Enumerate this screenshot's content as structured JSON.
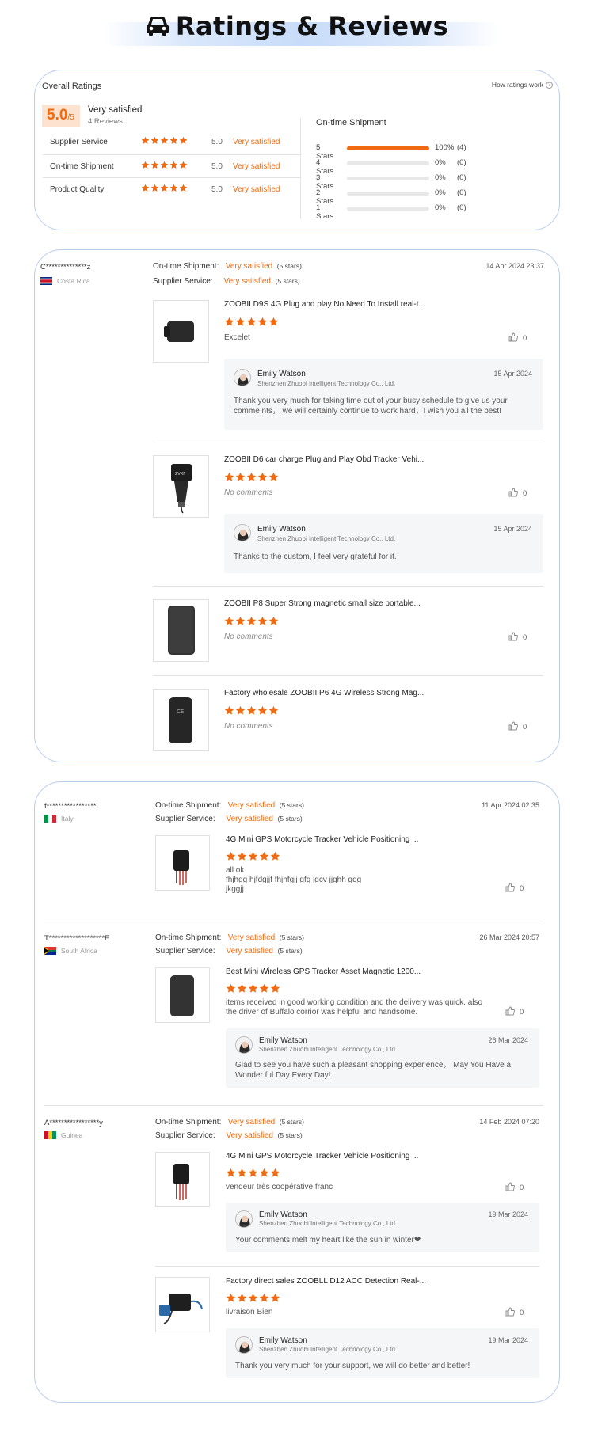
{
  "header": {
    "title": "Ratings & Reviews",
    "icon": "car-icon"
  },
  "colors": {
    "accent": "#f06a12",
    "border": "#b9cdec",
    "score_bg": "#fde2cf"
  },
  "overall": {
    "title": "Overall Ratings",
    "help_label": "How ratings work",
    "score": "5.0",
    "score_max": "/5",
    "satisfaction": "Very satisfied",
    "reviews_count": "4 Reviews",
    "categories": [
      {
        "label": "Supplier Service",
        "value": "5.0",
        "satisfaction": "Very satisfied",
        "stars": 5
      },
      {
        "label": "On-time Shipment",
        "value": "5.0",
        "satisfaction": "Very satisfied",
        "stars": 5
      },
      {
        "label": "Product Quality",
        "value": "5.0",
        "satisfaction": "Very satisfied",
        "stars": 5
      }
    ],
    "shipment_title": "On-time Shipment",
    "distribution": [
      {
        "label": "5 Stars",
        "percent": "100%",
        "count": "(4)",
        "fill": 100
      },
      {
        "label": "4 Stars",
        "percent": "0%",
        "count": "(0)",
        "fill": 0
      },
      {
        "label": "3 Stars",
        "percent": "0%",
        "count": "(0)",
        "fill": 0
      },
      {
        "label": "2 Stars",
        "percent": "0%",
        "count": "(0)",
        "fill": 0
      },
      {
        "label": "1 Stars",
        "percent": "0%",
        "count": "(0)",
        "fill": 0
      }
    ]
  },
  "metric_labels": {
    "shipment": "On-time Shipment:",
    "service": "Supplier Service:",
    "value": "Very satisfied",
    "stars": "(5 stars)"
  },
  "reply_author": {
    "name": "Emily Watson",
    "company": "Shenzhen Zhuobi Intelligent Technology Co., Ltd."
  },
  "reviews": [
    {
      "user": "C**************z",
      "country": "Costa Rica",
      "date": "14 Apr 2024 23:37",
      "items": [
        {
          "title": "ZOOBII D9S 4G Plug and play No Need To Install real-t...",
          "comment": "Excelet",
          "likes": "0",
          "reply": {
            "date": "15 Apr 2024",
            "text": "Thank you very much for taking time out of your busy schedule to give us your comme nts， we will certainly continue to work hard，I wish you all the best!"
          }
        },
        {
          "title": "ZOOBII D6 car charge Plug and Play Obd Tracker Vehi...",
          "comment": "No comments",
          "likes": "0",
          "reply": {
            "date": "15 Apr 2024",
            "text": "Thanks to the custom, I feel very grateful for it."
          }
        },
        {
          "title": "ZOOBII P8 Super Strong magnetic small size portable...",
          "comment": "No comments",
          "likes": "0"
        },
        {
          "title": "Factory wholesale ZOOBII P6 4G Wireless Strong Mag...",
          "comment": "No comments",
          "likes": "0"
        }
      ]
    },
    {
      "user": "f*****************i",
      "country": "Italy",
      "date": "11 Apr 2024 02:35",
      "items": [
        {
          "title": "4G Mini GPS Motorcycle Tracker Vehicle Positioning ...",
          "comment_lines": [
            "all ok",
            "fhjhgg hjfdgjjf fhjhfgjj gfg jgcv jjghh gdg",
            "jkggjj"
          ],
          "likes": "0"
        }
      ]
    },
    {
      "user": "T*******************E",
      "country": "South Africa",
      "date": "26 Mar 2024 20:57",
      "items": [
        {
          "title": "Best Mini Wireless GPS Tracker Asset Magnetic 1200...",
          "comment_lines": [
            "items received in good working condition and the delivery was quick. also",
            "the driver of Buffalo corrior was helpful and handsome."
          ],
          "likes": "0",
          "reply": {
            "date": "26 Mar 2024",
            "text": "Glad to see you have such a pleasant shopping experience， May You Have a Wonder ful Day Every Day!"
          }
        }
      ]
    },
    {
      "user": "A*****************y",
      "country": "Guinea",
      "date": "14 Feb 2024 07:20",
      "items": [
        {
          "title": "4G Mini GPS Motorcycle Tracker Vehicle Positioning ...",
          "comment": "vendeur très coopérative franc",
          "likes": "0",
          "reply": {
            "date": "19 Mar 2024",
            "text": "Your comments melt my heart like the sun in winter❤"
          }
        },
        {
          "title": "Factory direct sales ZOOBLL D12 ACC Detection Real-...",
          "comment": "livraison Bien",
          "likes": "0",
          "reply": {
            "date": "19 Mar 2024",
            "text": "Thank you very much for your support, we will do better and better!"
          }
        }
      ]
    }
  ]
}
